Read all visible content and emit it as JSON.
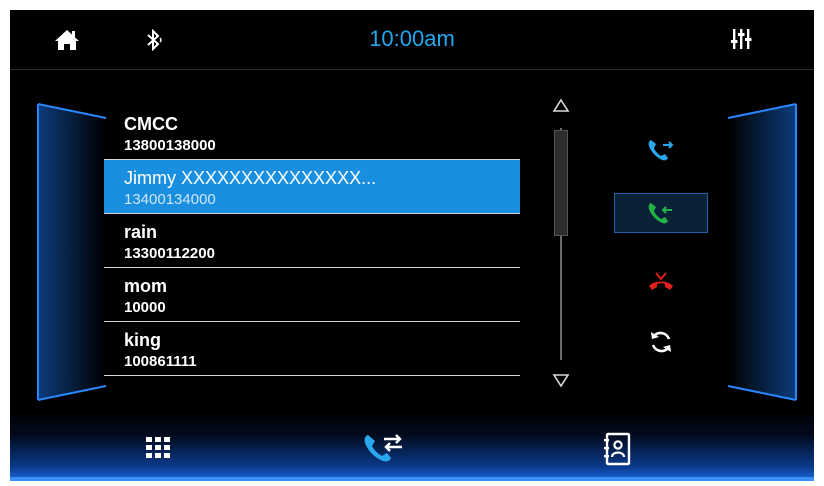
{
  "status_bar": {
    "time": "10:00am",
    "icons": [
      "home-icon",
      "bluetooth-icon",
      "equalizer-icon"
    ]
  },
  "contacts": [
    {
      "name": "CMCC",
      "number": "13800138000",
      "selected": false
    },
    {
      "name": "Jimmy XXXXXXXXXXXXXXX...",
      "number": "13400134000",
      "selected": true
    },
    {
      "name": "rain",
      "number": "13300112200",
      "selected": false
    },
    {
      "name": "mom",
      "number": "10000",
      "selected": false
    },
    {
      "name": "king",
      "number": "100861111",
      "selected": false
    }
  ],
  "call_controls": [
    "outgoing-call-icon",
    "incoming-call-icon",
    "hang-up-icon",
    "refresh-icon"
  ],
  "bottom_nav": [
    "dialpad-icon",
    "call-log-icon",
    "contacts-book-icon"
  ],
  "colors": {
    "accent": "#1fa8f0",
    "selected_row": "#1a8fe0",
    "answer_green": "#21b24a",
    "hangup_red": "#e0201b",
    "outgoing_blue": "#2aa7ef"
  }
}
